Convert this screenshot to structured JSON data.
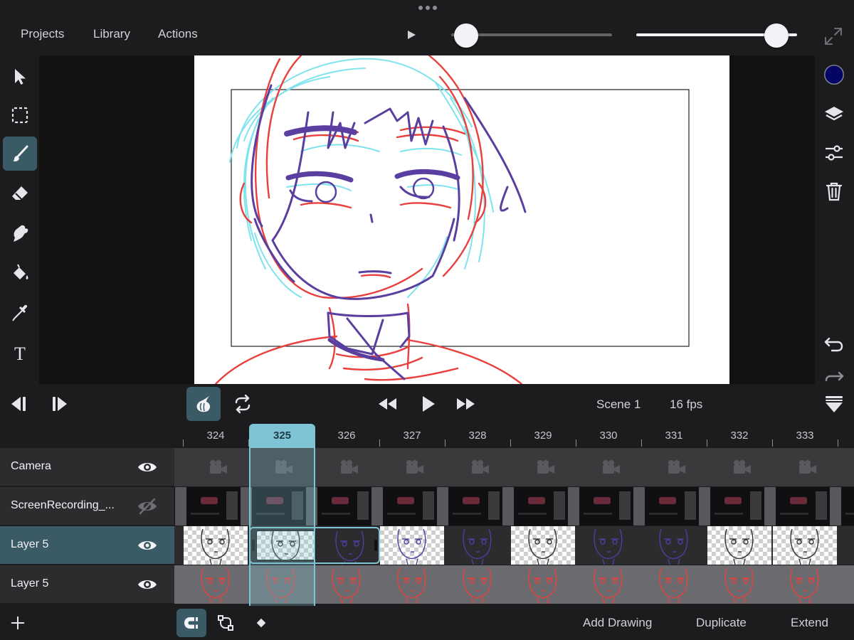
{
  "menu": {
    "projects": "Projects",
    "library": "Library",
    "actions": "Actions"
  },
  "sliders": {
    "frame_scrub": 0.02,
    "opacity": 0.94
  },
  "colors": {
    "accent": "#3a5a66",
    "playhead": "#7ec4d4",
    "current_color": "#050566",
    "sketch_red": "#e8403c",
    "sketch_cyan": "#7fe3ee",
    "sketch_purple": "#5a3fa0"
  },
  "left_tools": [
    "select-arrow",
    "marquee-select",
    "brush",
    "eraser",
    "smudge",
    "paint-bucket",
    "eyedropper",
    "text"
  ],
  "active_tool": "brush",
  "right_tools": [
    "color-swatch",
    "layers",
    "adjustments",
    "trash",
    "undo",
    "redo"
  ],
  "transport": {
    "scene": "Scene 1",
    "fps": "16 fps"
  },
  "timeline": {
    "frames": [
      "324",
      "325",
      "326",
      "327",
      "328",
      "329",
      "330",
      "331",
      "332",
      "333"
    ],
    "current_frame": "325",
    "layers": [
      {
        "name": "Camera",
        "visible": true
      },
      {
        "name": "ScreenRecording_...",
        "visible": false
      },
      {
        "name": "Layer 5",
        "visible": true,
        "active": true
      },
      {
        "name": "Layer 5",
        "visible": true
      }
    ]
  },
  "bottom": {
    "add_drawing": "Add Drawing",
    "duplicate": "Duplicate",
    "extend": "Extend"
  }
}
